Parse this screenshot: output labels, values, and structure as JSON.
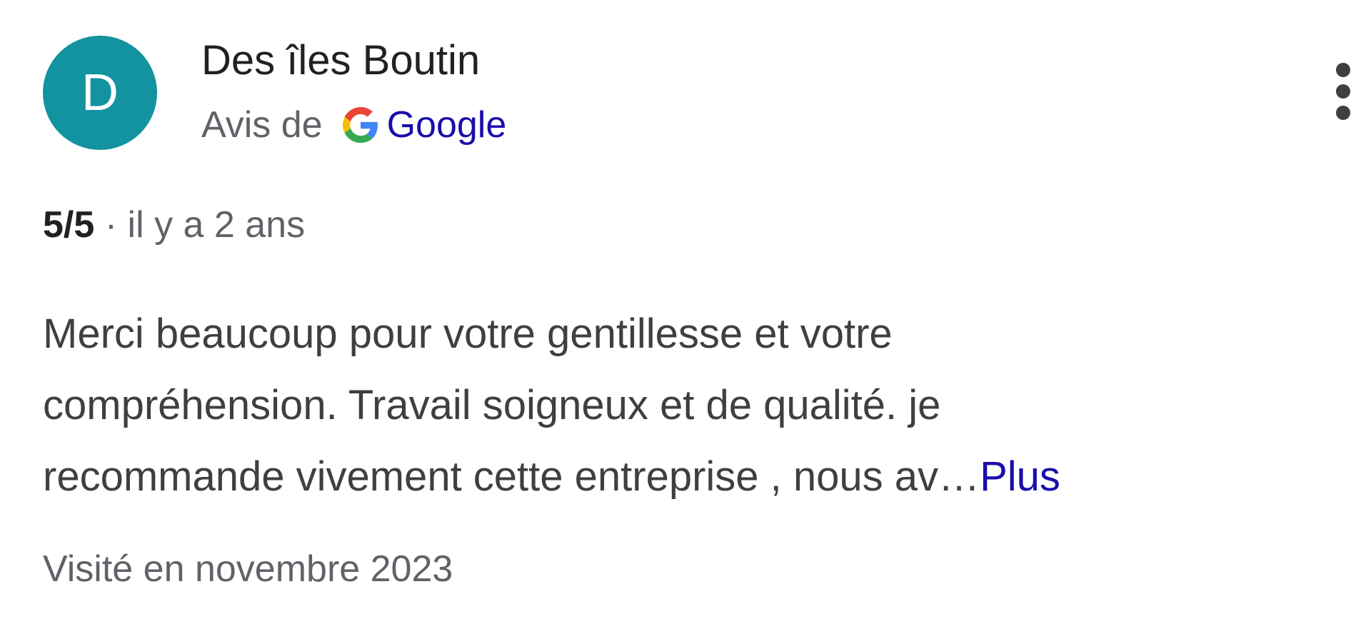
{
  "review": {
    "author_initial": "D",
    "author_name": "Des îles Boutin",
    "source_prefix": "Avis de",
    "source_name": "Google",
    "rating": "5/5",
    "separator": "·",
    "time_ago": "il y a 2 ans",
    "text_lines": [
      "Merci beaucoup pour votre gentillesse et votre",
      "compréhension. Travail soigneux et de qualité. je",
      "recommande vivement cette entreprise , nous av…"
    ],
    "more_label": "Plus",
    "visited": "Visité en novembre 2023"
  },
  "icons": {
    "source_logo": "google-g-icon",
    "menu": "more-vertical-icon"
  },
  "colors": {
    "avatar_bg": "#12939f",
    "link": "#1a0dab",
    "secondary_text": "#5f6368"
  }
}
